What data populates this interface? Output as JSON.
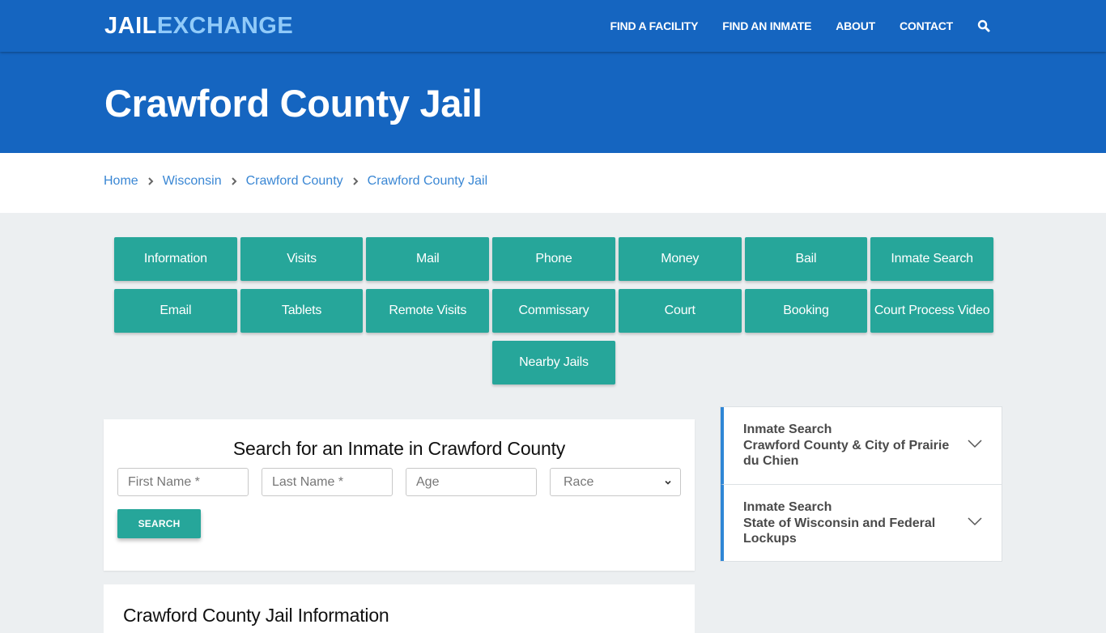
{
  "brand": {
    "logo_part1": "JAIL",
    "logo_part2": "EXCHANGE"
  },
  "nav": {
    "items": [
      "FIND A FACILITY",
      "FIND AN INMATE",
      "ABOUT",
      "CONTACT"
    ],
    "search_icon": "search-icon"
  },
  "hero": {
    "title": "Crawford County Jail"
  },
  "breadcrumb": [
    "Home",
    "Wisconsin",
    "Crawford County",
    "Crawford County Jail"
  ],
  "tiles": {
    "row1": [
      "Information",
      "Visits",
      "Mail",
      "Phone",
      "Money",
      "Bail",
      "Inmate Search"
    ],
    "row2": [
      "Email",
      "Tablets",
      "Remote Visits",
      "Commissary",
      "Court",
      "Booking",
      "Court Process Video"
    ],
    "row3": [
      "Nearby Jails"
    ]
  },
  "search": {
    "title": "Search for an Inmate in Crawford County",
    "first_name_placeholder": "First Name *",
    "last_name_placeholder": "Last Name *",
    "age_placeholder": "Age",
    "race_selected": "Race",
    "button_label": "SEARCH"
  },
  "info": {
    "title": "Crawford County Jail Information"
  },
  "sidebar": {
    "items": [
      {
        "line1": "Inmate Search",
        "line2": "Crawford County & City of Prairie du Chien"
      },
      {
        "line1": "Inmate Search",
        "line2": "State of Wisconsin and Federal Lockups"
      }
    ]
  },
  "colors": {
    "primary": "#1565c0",
    "accent": "#26a69a",
    "logo_accent": "#90caf9",
    "link": "#3a87d4"
  }
}
